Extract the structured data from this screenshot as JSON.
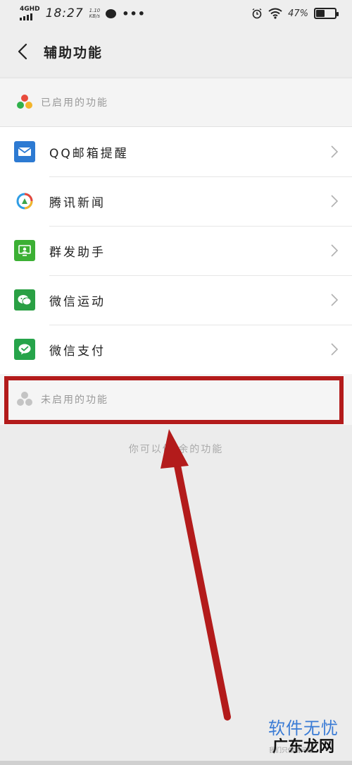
{
  "status_bar": {
    "network": "4GHD",
    "time": "18:27",
    "speed_value": "1.10",
    "speed_unit": "KB/s",
    "more": "•••",
    "battery_percent": "47%",
    "battery_level": 0.47
  },
  "header": {
    "title": "辅助功能"
  },
  "enabled_section": {
    "label": "已启用的功能"
  },
  "features": [
    {
      "label": "QQ邮箱提醒",
      "icon": "mail-icon",
      "color": "#2d7ad2"
    },
    {
      "label": "腾讯新闻",
      "icon": "tencent-news-icon",
      "color": "#ffffff"
    },
    {
      "label": "群发助手",
      "icon": "group-send-icon",
      "color": "#3cb034"
    },
    {
      "label": "微信运动",
      "icon": "wechat-sport-icon",
      "color": "#2aa044"
    },
    {
      "label": "微信支付",
      "icon": "wechat-pay-icon",
      "color": "#26a44a"
    }
  ],
  "disabled_section": {
    "label": "未启用的功能"
  },
  "hint": {
    "text": "你可以停     余的功能"
  },
  "watermark": {
    "top": "软件无忧",
    "bottom": "广东龙网",
    "small": "我们只做精问题"
  },
  "annotation_color": "#b31b1b"
}
